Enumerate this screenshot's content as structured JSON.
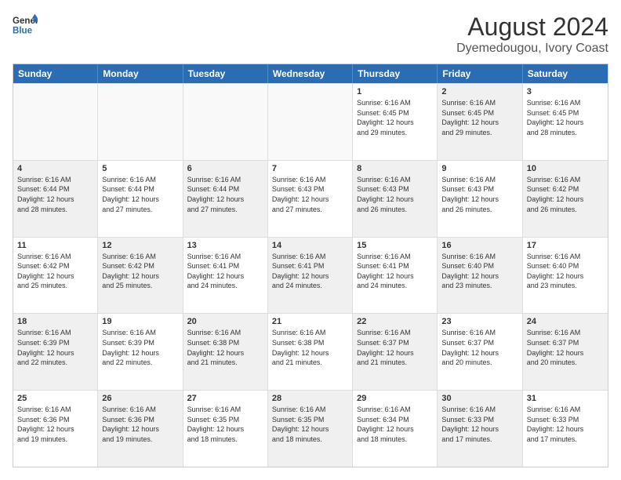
{
  "header": {
    "logo_line1": "General",
    "logo_line2": "Blue",
    "main_title": "August 2024",
    "subtitle": "Dyemedougou, Ivory Coast"
  },
  "weekdays": [
    "Sunday",
    "Monday",
    "Tuesday",
    "Wednesday",
    "Thursday",
    "Friday",
    "Saturday"
  ],
  "rows": [
    [
      {
        "day": "",
        "text": "",
        "empty": true
      },
      {
        "day": "",
        "text": "",
        "empty": true
      },
      {
        "day": "",
        "text": "",
        "empty": true
      },
      {
        "day": "",
        "text": "",
        "empty": true
      },
      {
        "day": "1",
        "text": "Sunrise: 6:16 AM\nSunset: 6:45 PM\nDaylight: 12 hours\nand 29 minutes.",
        "shaded": false
      },
      {
        "day": "2",
        "text": "Sunrise: 6:16 AM\nSunset: 6:45 PM\nDaylight: 12 hours\nand 29 minutes.",
        "shaded": true
      },
      {
        "day": "3",
        "text": "Sunrise: 6:16 AM\nSunset: 6:45 PM\nDaylight: 12 hours\nand 28 minutes.",
        "shaded": false
      }
    ],
    [
      {
        "day": "4",
        "text": "Sunrise: 6:16 AM\nSunset: 6:44 PM\nDaylight: 12 hours\nand 28 minutes.",
        "shaded": true
      },
      {
        "day": "5",
        "text": "Sunrise: 6:16 AM\nSunset: 6:44 PM\nDaylight: 12 hours\nand 27 minutes.",
        "shaded": false
      },
      {
        "day": "6",
        "text": "Sunrise: 6:16 AM\nSunset: 6:44 PM\nDaylight: 12 hours\nand 27 minutes.",
        "shaded": true
      },
      {
        "day": "7",
        "text": "Sunrise: 6:16 AM\nSunset: 6:43 PM\nDaylight: 12 hours\nand 27 minutes.",
        "shaded": false
      },
      {
        "day": "8",
        "text": "Sunrise: 6:16 AM\nSunset: 6:43 PM\nDaylight: 12 hours\nand 26 minutes.",
        "shaded": true
      },
      {
        "day": "9",
        "text": "Sunrise: 6:16 AM\nSunset: 6:43 PM\nDaylight: 12 hours\nand 26 minutes.",
        "shaded": false
      },
      {
        "day": "10",
        "text": "Sunrise: 6:16 AM\nSunset: 6:42 PM\nDaylight: 12 hours\nand 26 minutes.",
        "shaded": true
      }
    ],
    [
      {
        "day": "11",
        "text": "Sunrise: 6:16 AM\nSunset: 6:42 PM\nDaylight: 12 hours\nand 25 minutes.",
        "shaded": false
      },
      {
        "day": "12",
        "text": "Sunrise: 6:16 AM\nSunset: 6:42 PM\nDaylight: 12 hours\nand 25 minutes.",
        "shaded": true
      },
      {
        "day": "13",
        "text": "Sunrise: 6:16 AM\nSunset: 6:41 PM\nDaylight: 12 hours\nand 24 minutes.",
        "shaded": false
      },
      {
        "day": "14",
        "text": "Sunrise: 6:16 AM\nSunset: 6:41 PM\nDaylight: 12 hours\nand 24 minutes.",
        "shaded": true
      },
      {
        "day": "15",
        "text": "Sunrise: 6:16 AM\nSunset: 6:41 PM\nDaylight: 12 hours\nand 24 minutes.",
        "shaded": false
      },
      {
        "day": "16",
        "text": "Sunrise: 6:16 AM\nSunset: 6:40 PM\nDaylight: 12 hours\nand 23 minutes.",
        "shaded": true
      },
      {
        "day": "17",
        "text": "Sunrise: 6:16 AM\nSunset: 6:40 PM\nDaylight: 12 hours\nand 23 minutes.",
        "shaded": false
      }
    ],
    [
      {
        "day": "18",
        "text": "Sunrise: 6:16 AM\nSunset: 6:39 PM\nDaylight: 12 hours\nand 22 minutes.",
        "shaded": true
      },
      {
        "day": "19",
        "text": "Sunrise: 6:16 AM\nSunset: 6:39 PM\nDaylight: 12 hours\nand 22 minutes.",
        "shaded": false
      },
      {
        "day": "20",
        "text": "Sunrise: 6:16 AM\nSunset: 6:38 PM\nDaylight: 12 hours\nand 21 minutes.",
        "shaded": true
      },
      {
        "day": "21",
        "text": "Sunrise: 6:16 AM\nSunset: 6:38 PM\nDaylight: 12 hours\nand 21 minutes.",
        "shaded": false
      },
      {
        "day": "22",
        "text": "Sunrise: 6:16 AM\nSunset: 6:37 PM\nDaylight: 12 hours\nand 21 minutes.",
        "shaded": true
      },
      {
        "day": "23",
        "text": "Sunrise: 6:16 AM\nSunset: 6:37 PM\nDaylight: 12 hours\nand 20 minutes.",
        "shaded": false
      },
      {
        "day": "24",
        "text": "Sunrise: 6:16 AM\nSunset: 6:37 PM\nDaylight: 12 hours\nand 20 minutes.",
        "shaded": true
      }
    ],
    [
      {
        "day": "25",
        "text": "Sunrise: 6:16 AM\nSunset: 6:36 PM\nDaylight: 12 hours\nand 19 minutes.",
        "shaded": false
      },
      {
        "day": "26",
        "text": "Sunrise: 6:16 AM\nSunset: 6:36 PM\nDaylight: 12 hours\nand 19 minutes.",
        "shaded": true
      },
      {
        "day": "27",
        "text": "Sunrise: 6:16 AM\nSunset: 6:35 PM\nDaylight: 12 hours\nand 18 minutes.",
        "shaded": false
      },
      {
        "day": "28",
        "text": "Sunrise: 6:16 AM\nSunset: 6:35 PM\nDaylight: 12 hours\nand 18 minutes.",
        "shaded": true
      },
      {
        "day": "29",
        "text": "Sunrise: 6:16 AM\nSunset: 6:34 PM\nDaylight: 12 hours\nand 18 minutes.",
        "shaded": false
      },
      {
        "day": "30",
        "text": "Sunrise: 6:16 AM\nSunset: 6:33 PM\nDaylight: 12 hours\nand 17 minutes.",
        "shaded": true
      },
      {
        "day": "31",
        "text": "Sunrise: 6:16 AM\nSunset: 6:33 PM\nDaylight: 12 hours\nand 17 minutes.",
        "shaded": false
      }
    ]
  ]
}
